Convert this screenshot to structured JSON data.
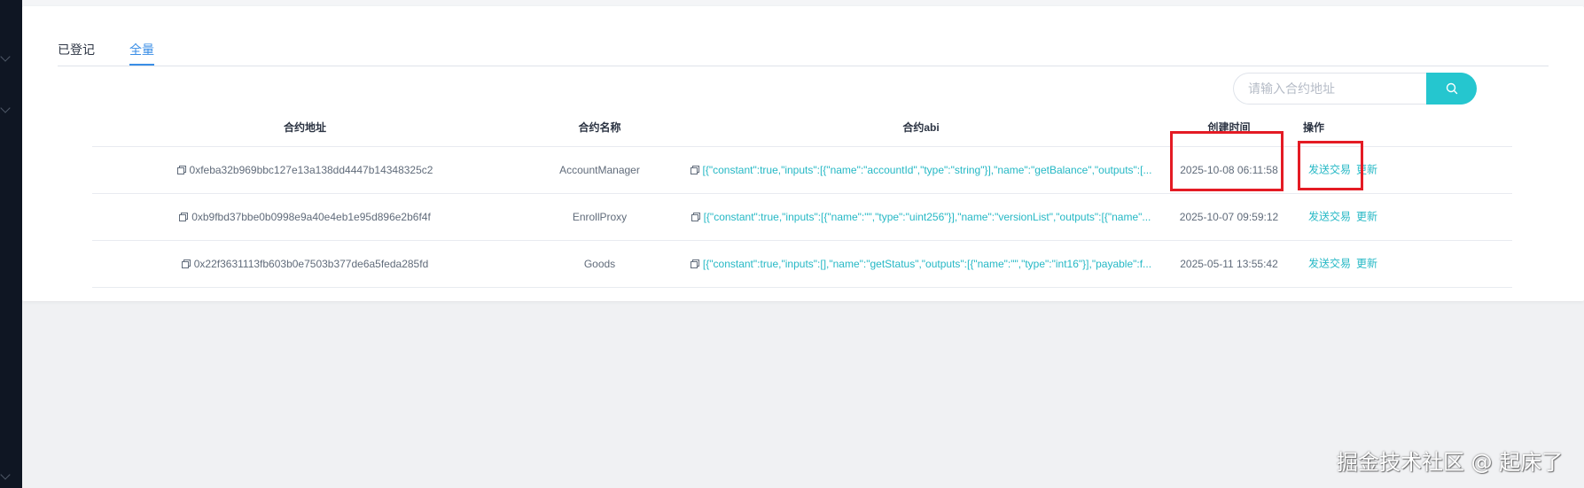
{
  "tabs": [
    {
      "label": "已登记",
      "active": false
    },
    {
      "label": "全量",
      "active": true
    }
  ],
  "search": {
    "placeholder": "请输入合约地址",
    "icon": "search-icon"
  },
  "table": {
    "headers": {
      "address": "合约地址",
      "name": "合约名称",
      "abi": "合约abi",
      "created": "创建时间",
      "actions": "操作"
    },
    "rows": [
      {
        "address": "0xfeba32b969bbc127e13a138dd4447b14348325c2",
        "name": "AccountManager",
        "abi": "[{\"constant\":true,\"inputs\":[{\"name\":\"accountId\",\"type\":\"string\"}],\"name\":\"getBalance\",\"outputs\":[...",
        "created": "2025-10-08 06:11:58",
        "send": "发送交易",
        "update": "更新"
      },
      {
        "address": "0xb9fbd37bbe0b0998e9a40e4eb1e95d896e2b6f4f",
        "name": "EnrollProxy",
        "abi": "[{\"constant\":true,\"inputs\":[{\"name\":\"\",\"type\":\"uint256\"}],\"name\":\"versionList\",\"outputs\":[{\"name\"...",
        "created": "2025-10-07 09:59:12",
        "send": "发送交易",
        "update": "更新"
      },
      {
        "address": "0x22f3631113fb603b0e7503b377de6a5feda285fd",
        "name": "Goods",
        "abi": "[{\"constant\":true,\"inputs\":[],\"name\":\"getStatus\",\"outputs\":[{\"name\":\"\",\"type\":\"int16\"}],\"payable\":f...",
        "created": "2025-05-11 13:55:42",
        "send": "发送交易",
        "update": "更新"
      }
    ]
  },
  "colors": {
    "accent": "#25c6cf",
    "link": "#25b8c5",
    "tab_active": "#3a8ee6",
    "highlight": "#e41b24"
  },
  "watermark": "掘金技术社区 @ 起床了"
}
